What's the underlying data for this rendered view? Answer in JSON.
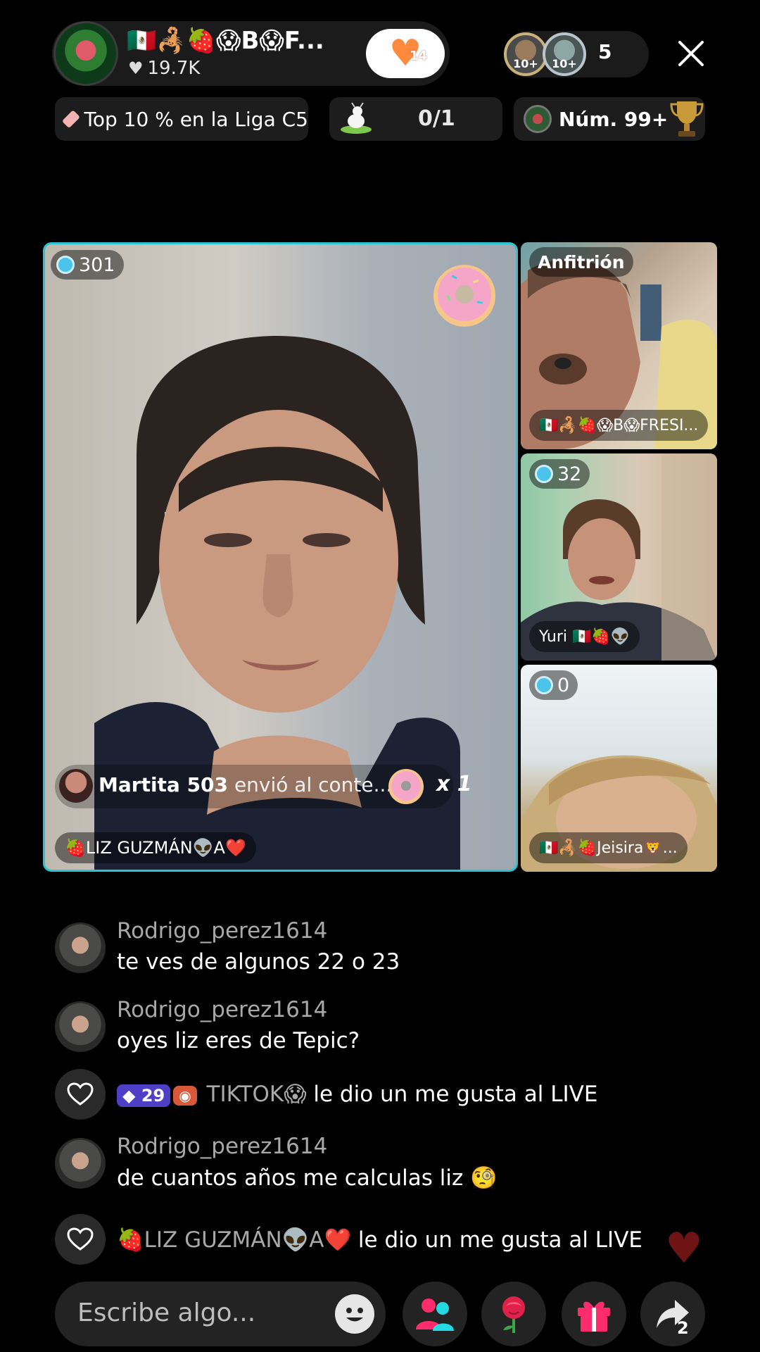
{
  "host": {
    "name": "🇲🇽🦂🍓😱B😱F...",
    "likes": "19.7K",
    "follow_count": "14"
  },
  "viewers": {
    "badge_1": "10+",
    "badge_2": "10+",
    "count": "5"
  },
  "chips": {
    "league": "Top 10 % en la Liga C5",
    "goal": "0/1",
    "rank": "Núm. 99+"
  },
  "main_video": {
    "score": "301",
    "gift_user": "Martita 503",
    "gift_text": "envió al conte...",
    "gift_mult": "x 1",
    "name": "🍓LIZ GUZMÁN👽A❤️"
  },
  "tiles": [
    {
      "tag": "Anfitrión",
      "name": "🇲🇽🦂🍓😱B😱FRESI..."
    },
    {
      "score": "32",
      "name": "Yuri 🇲🇽🍓👽"
    },
    {
      "score": "0",
      "name": "🇲🇽🦂🍓Jeisira🦁..."
    }
  ],
  "comments": [
    {
      "user": "Rodrigo_perez1614",
      "text": "te ves de algunos 22 o 23"
    },
    {
      "user": "Rodrigo_perez1614",
      "text": "oyes liz eres de Tepic?"
    },
    {
      "gem": "29",
      "user": "TIKTOK😱",
      "text": "le dio un me gusta al LIVE"
    },
    {
      "user": "Rodrigo_perez1614",
      "text": "de cuantos años me calculas liz 🧐"
    },
    {
      "user": "🍓LIZ GUZMÁN👽A❤️",
      "text": "le dio un me gusta al LIVE"
    }
  ],
  "input": {
    "placeholder": "Escribe algo..."
  },
  "share_count": "2",
  "colors": {
    "accent_cyan": "#2ac3cf",
    "gem_purple": "#4f3fc7",
    "gift_pink": "#ff2c6d"
  }
}
